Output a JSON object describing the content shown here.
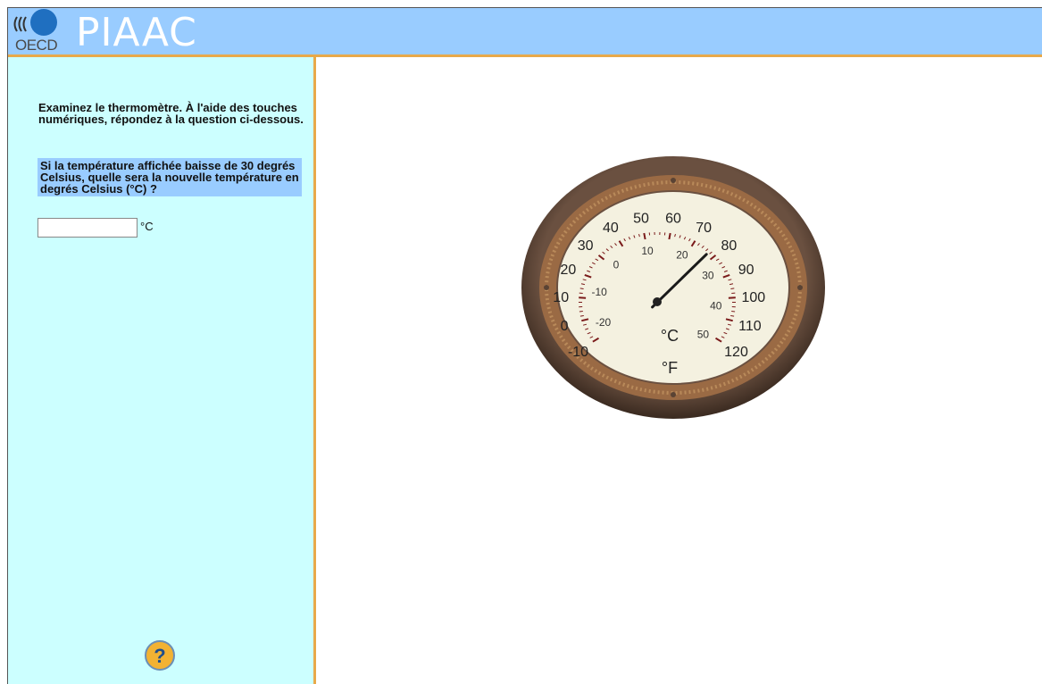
{
  "header": {
    "logo_text": "OECD",
    "brand": "PIAAC"
  },
  "sidebar": {
    "instruction": "Examinez le thermomètre. À l'aide des touches numériques, répondez à la question ci-dessous.",
    "question": "Si la température affichée baisse de 30 degrés Celsius, quelle sera la nouvelle température en degrés Celsius (°C) ?",
    "answer_value": "",
    "answer_unit": "°C",
    "help_symbol": "?"
  },
  "thermometer": {
    "fahrenheit_labels": [
      "-10",
      "0",
      "10",
      "20",
      "30",
      "40",
      "50",
      "60",
      "70",
      "80",
      "90",
      "100",
      "110",
      "120"
    ],
    "celsius_labels": [
      "-20",
      "-10",
      "0",
      "10",
      "20",
      "30",
      "40",
      "50"
    ],
    "celsius_unit": "°C",
    "fahrenheit_unit": "°F",
    "needle_reading_f": 77,
    "colors": {
      "bezel": "#5a4334",
      "copper": "#9a6a44",
      "face": "#f4f1e0",
      "ticks": "#7a1a1a"
    }
  }
}
